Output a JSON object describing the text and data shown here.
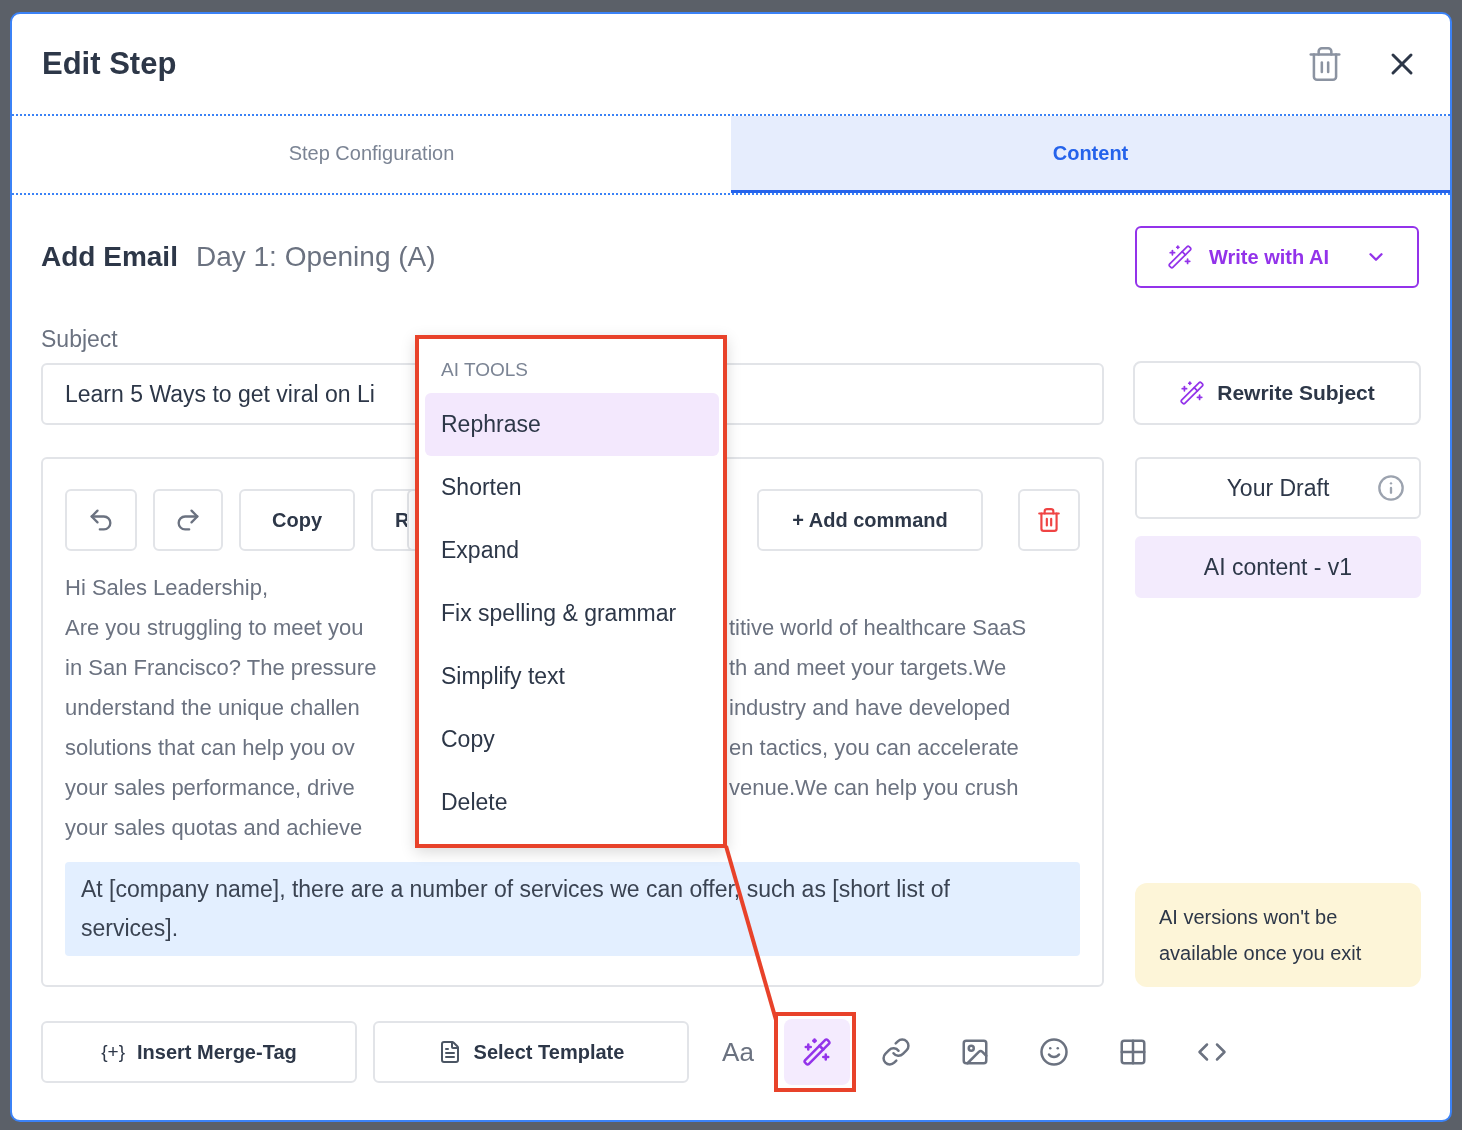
{
  "dialog": {
    "title": "Edit Step"
  },
  "tabs": [
    {
      "label": "Step Configuration",
      "selected": false
    },
    {
      "label": "Content",
      "selected": true
    }
  ],
  "email": {
    "heading": "Add Email",
    "name": "Day 1: Opening (A)"
  },
  "write_with_ai": {
    "label": "Write with AI"
  },
  "subject": {
    "label": "Subject",
    "value": "Learn 5 Ways to get viral on Li"
  },
  "rewrite_subject": {
    "label": "Rewrite Subject"
  },
  "editor_toolbar": [
    {
      "kind": "undo"
    },
    {
      "kind": "redo"
    },
    {
      "kind": "text",
      "label": "Copy"
    },
    {
      "kind": "text",
      "label": "R"
    },
    {
      "kind": "stub"
    },
    {
      "kind": "text",
      "label": "+ Add command"
    },
    {
      "kind": "delete"
    }
  ],
  "body_lines": [
    {
      "left": "Hi Sales Leadership,"
    },
    {
      "left": "Are you struggling to meet you",
      "right": "titive world of healthcare SaaS"
    },
    {
      "left": "in San Francisco? The pressure",
      "right": "th and meet your targets.We"
    },
    {
      "left": "understand the unique challen",
      "right": "industry and have developed"
    },
    {
      "left": "solutions that can help you ov",
      "right": "en tactics, you can accelerate"
    },
    {
      "left": "your sales performance, drive",
      "right": "venue.We can help you crush"
    },
    {
      "left": "your sales quotas and achieve"
    }
  ],
  "highlighted_paragraph": "At [company name], there are a number of services we can offer, such as [short list of services].",
  "versions": [
    {
      "label": "Your Draft",
      "selected": false,
      "info": true
    },
    {
      "label": "AI content - v1",
      "selected": true,
      "info": false
    }
  ],
  "note": "AI versions won't be available once you exit",
  "bottom_buttons": [
    {
      "kind": "merge_tag",
      "icon_text": "{+}",
      "label": "Insert Merge-Tag"
    },
    {
      "kind": "template",
      "label": "Select Template"
    }
  ],
  "tools": [
    {
      "kind": "font",
      "text": "Aa",
      "selected": false,
      "annotated": false
    },
    {
      "kind": "magic",
      "selected": true,
      "annotated": true
    },
    {
      "kind": "link",
      "selected": false,
      "annotated": false
    },
    {
      "kind": "image",
      "selected": false,
      "annotated": false
    },
    {
      "kind": "emoji",
      "selected": false,
      "annotated": false
    },
    {
      "kind": "table",
      "selected": false,
      "annotated": false
    },
    {
      "kind": "code",
      "selected": false,
      "annotated": false
    }
  ],
  "ai_menu": {
    "heading": "AI TOOLS",
    "items": [
      {
        "label": "Rephrase",
        "selected": true
      },
      {
        "label": "Shorten",
        "selected": false
      },
      {
        "label": "Expand",
        "selected": false
      },
      {
        "label": "Fix spelling & grammar",
        "selected": false
      },
      {
        "label": "Simplify text",
        "selected": false
      },
      {
        "label": "Copy",
        "selected": false
      },
      {
        "label": "Delete",
        "selected": false
      }
    ]
  }
}
